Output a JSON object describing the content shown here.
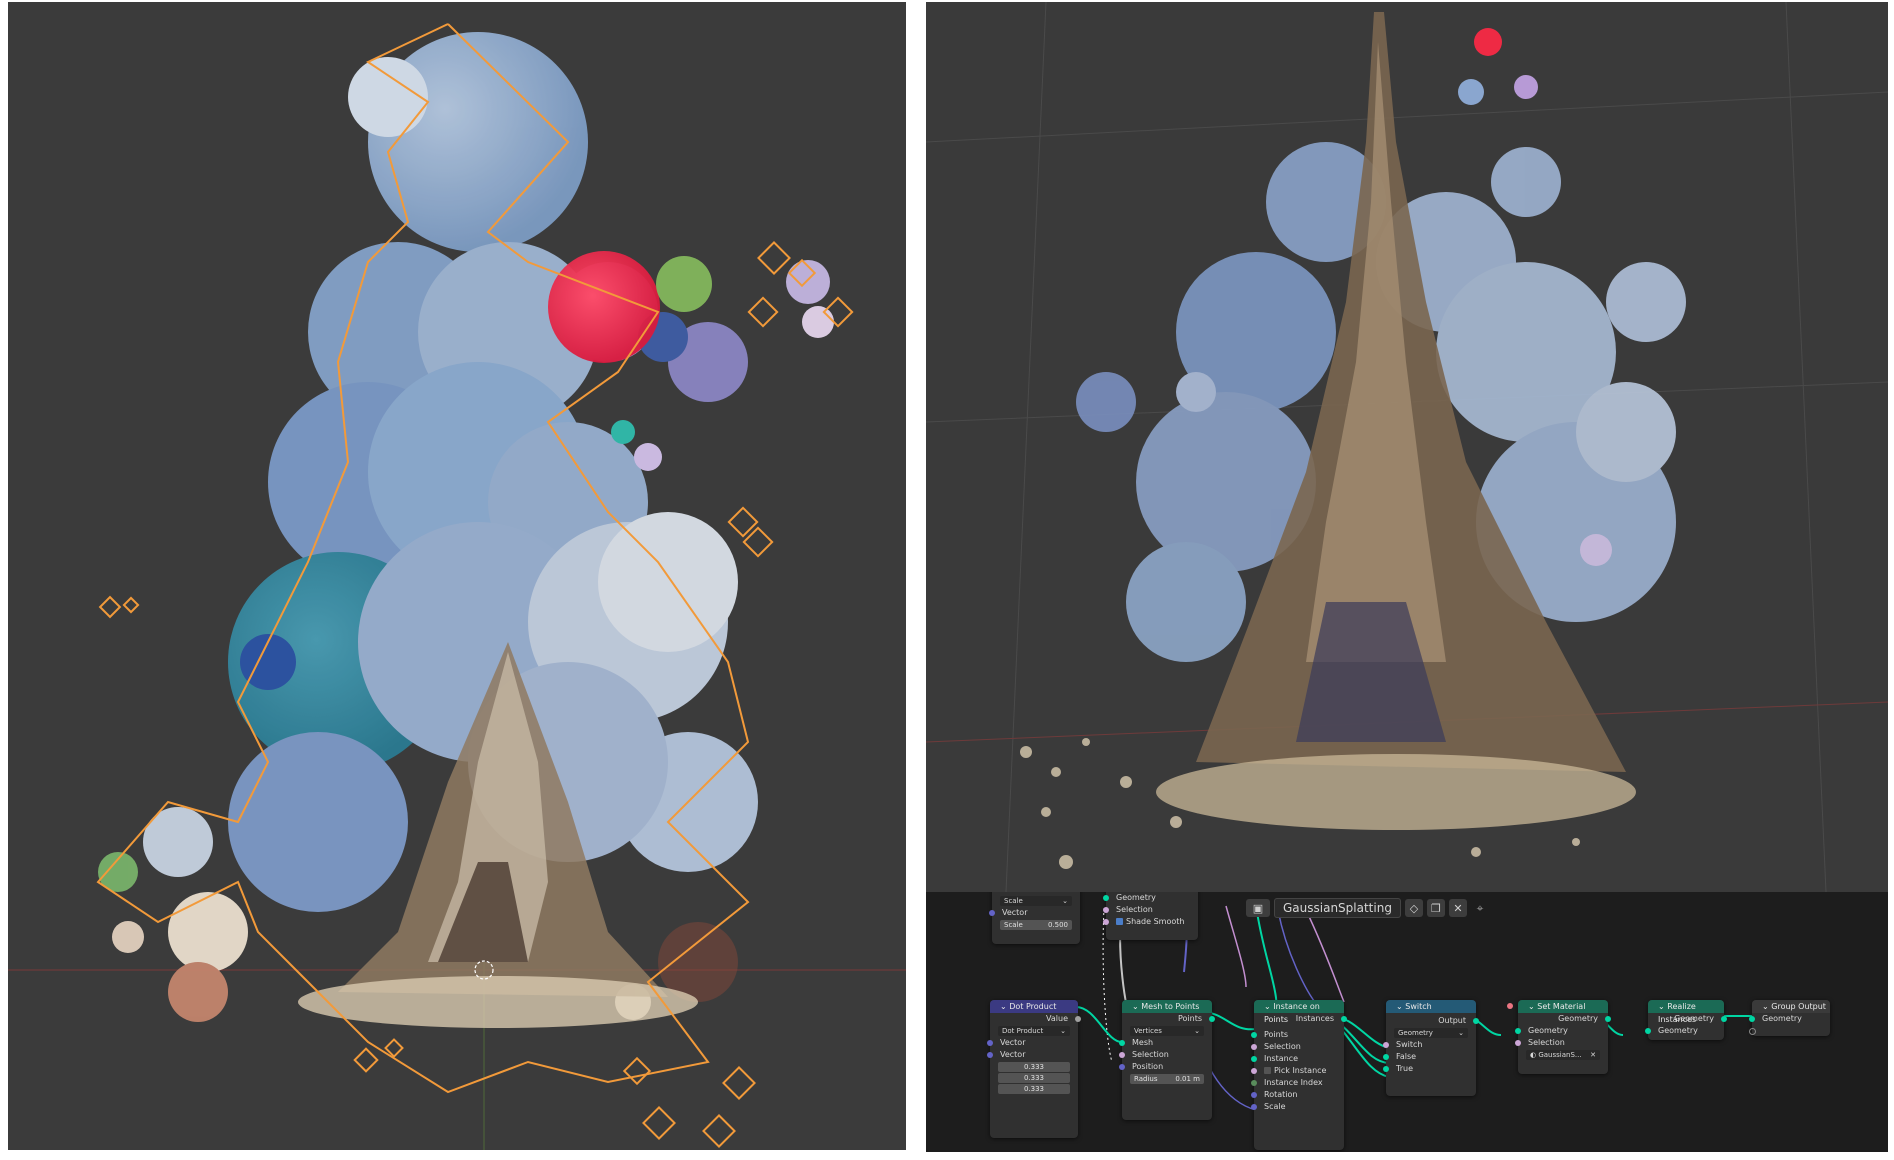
{
  "editor": {
    "title": "GaussianSplatting",
    "type_icon": "node-editor-icon",
    "buttons": [
      "shield-icon",
      "duplicate-icon",
      "close-icon",
      "pin-icon"
    ]
  },
  "nodes": {
    "top_scale": {
      "dropdown": "Scale",
      "in_vector": "Vector",
      "field_label": "Scale",
      "field_value": "0.500"
    },
    "top_mid": {
      "row1": "Geometry",
      "row2": "Selection",
      "row3": "Shade Smooth"
    },
    "dot_product": {
      "title": "Dot Product",
      "out_value": "Value",
      "dropdown": "Dot Product",
      "vector1": "Vector",
      "vector2": "Vector",
      "v0": "0.333",
      "v1": "0.333",
      "v2": "0.333"
    },
    "mesh_to_points": {
      "title": "Mesh to Points",
      "out_points": "Points",
      "dropdown": "Vertices",
      "in_mesh": "Mesh",
      "in_selection": "Selection",
      "in_position": "Position",
      "radius_label": "Radius",
      "radius_value": "0.01 m"
    },
    "instance_on_points": {
      "title": "Instance on Points",
      "out_instances": "Instances",
      "in_points": "Points",
      "in_selection": "Selection",
      "in_instance": "Instance",
      "pick_instance": "Pick Instance",
      "instance_index": "Instance Index",
      "rotation": "Rotation",
      "scale": "Scale"
    },
    "switch": {
      "title": "Switch",
      "out_output": "Output",
      "dropdown": "Geometry",
      "in_switch": "Switch",
      "in_false": "False",
      "in_true": "True"
    },
    "set_material": {
      "title": "Set Material",
      "out_geometry": "Geometry",
      "in_geometry": "Geometry",
      "in_selection": "Selection",
      "material": "GaussianS..."
    },
    "realize_instances": {
      "title": "Realize Instances",
      "out_geometry": "Geometry",
      "in_geometry": "Geometry"
    },
    "group_output": {
      "title": "Group Output",
      "in_geometry": "Geometry"
    }
  },
  "colors": {
    "viewport_bg": "#3b3b3b",
    "selection_outline": "#f29a3a",
    "node_editor_bg": "#1d1d1d",
    "geometry_link": "#00d6a3",
    "header_purple": "#3b3a82",
    "header_green": "#1b6a55",
    "header_blue": "#245a76"
  }
}
